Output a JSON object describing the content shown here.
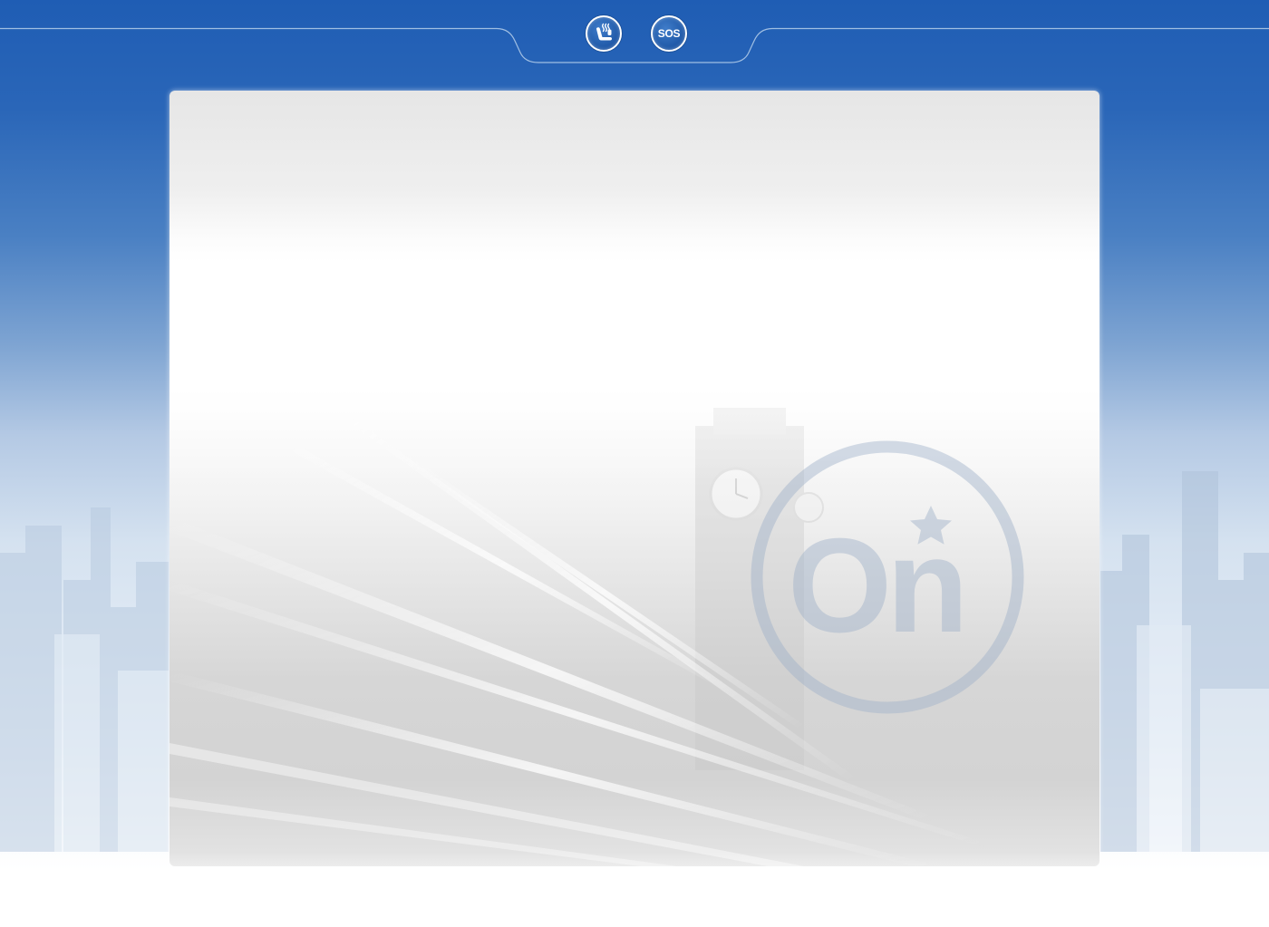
{
  "top_bar": {
    "seat_button_icon": "heated-seat-icon",
    "sos_button_icon": "sos-icon",
    "sos_label": "SOS"
  },
  "panel": {
    "logo_text": "On",
    "logo_icon": "star-icon"
  },
  "colors": {
    "brand_blue": "#1f5db4",
    "panel_white": "#ffffff",
    "logo_watermark": "#a9b8cc"
  }
}
